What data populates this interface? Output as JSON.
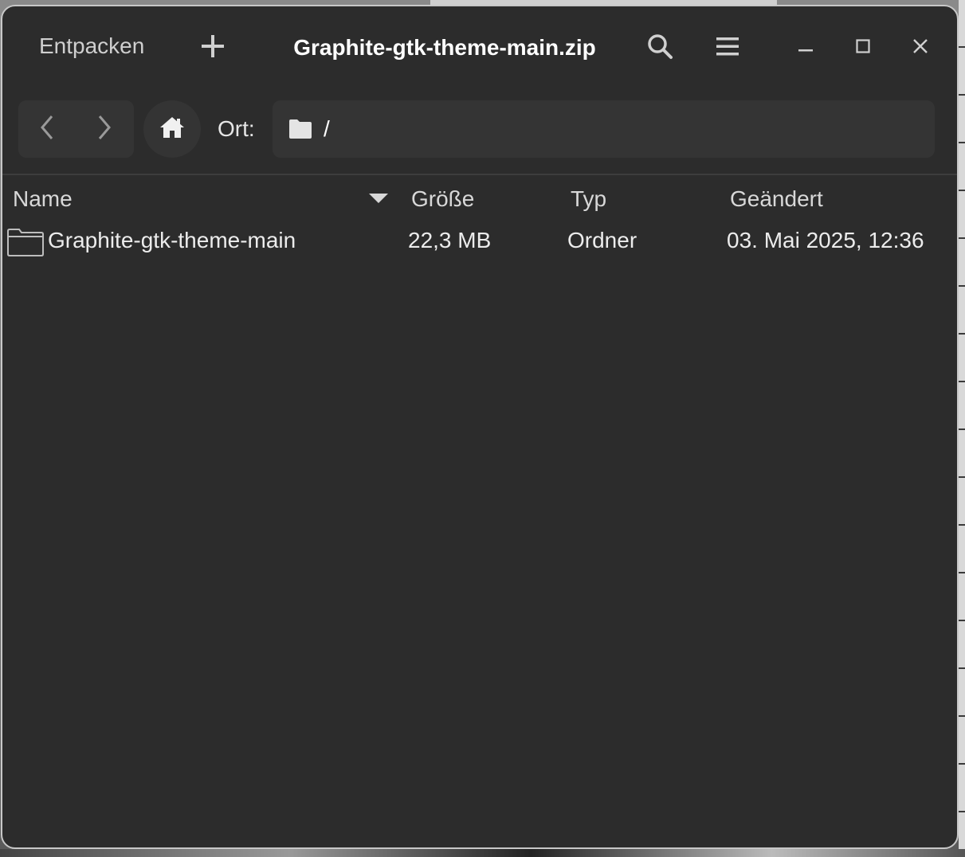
{
  "window": {
    "title": "Graphite-gtk-theme-main.zip"
  },
  "headerbar": {
    "extract_label": "Entpacken",
    "add_icon": "plus-icon",
    "search_icon": "search-icon",
    "menu_icon": "hamburger-menu-icon",
    "minimize_icon": "minimize-icon",
    "maximize_icon": "maximize-icon",
    "close_icon": "close-icon"
  },
  "location": {
    "label": "Ort:",
    "path": "/",
    "back_icon": "chevron-left-icon",
    "forward_icon": "chevron-right-icon",
    "home_icon": "home-icon",
    "folder_icon": "folder-icon"
  },
  "list": {
    "columns": [
      "Name",
      "Größe",
      "Typ",
      "Geändert"
    ],
    "sort_column": "Name",
    "sort_direction": "descending",
    "rows": [
      {
        "name": "Graphite-gtk-theme-main",
        "size": "22,3 MB",
        "type": "Ordner",
        "modified": "03. Mai 2025, 12:36",
        "icon": "folder-icon"
      }
    ]
  },
  "colors": {
    "window_bg": "#2c2c2c",
    "control_bg": "#343434",
    "text": "#dcdcdc",
    "title_text": "#ffffff",
    "border": "#c8c8c8"
  }
}
